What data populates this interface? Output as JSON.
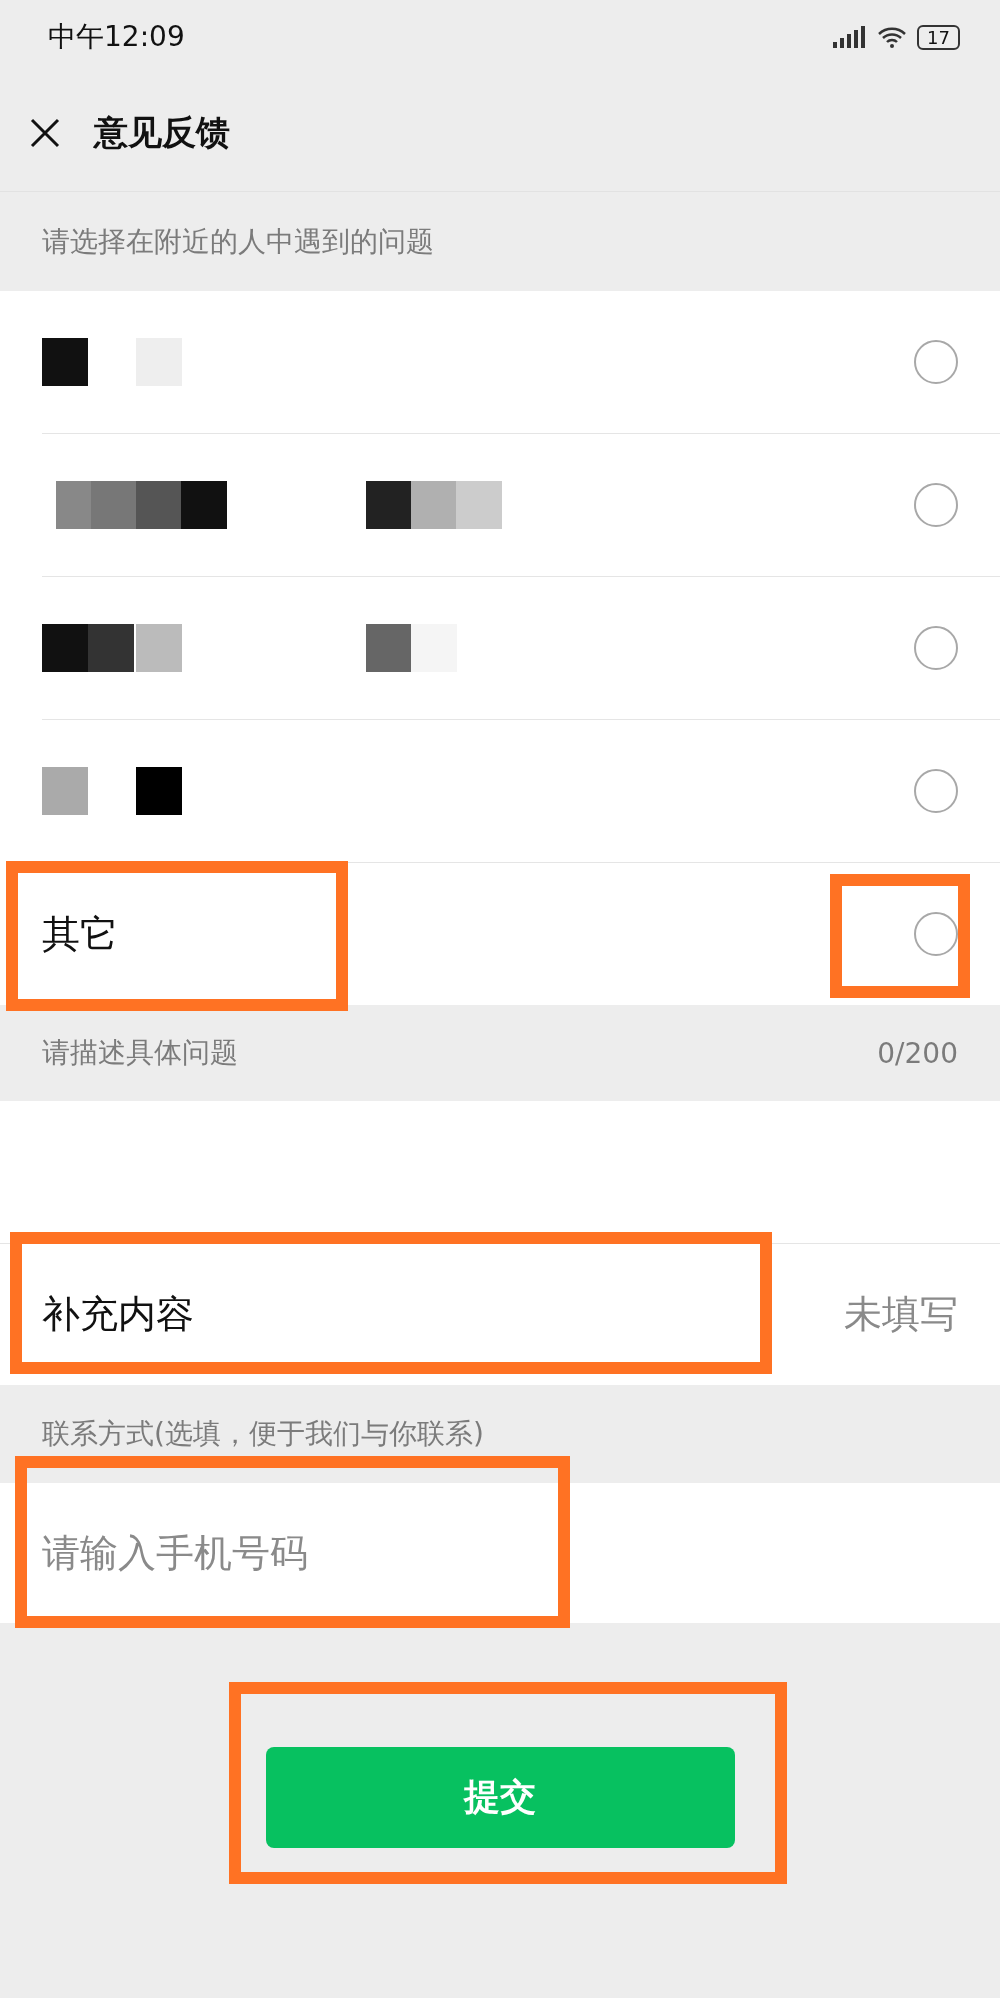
{
  "status_bar": {
    "time": "中午12:09",
    "battery": "17"
  },
  "header": {
    "title": "意见反馈"
  },
  "question": {
    "label": "请选择在附近的人中遇到的问题",
    "options": [
      {
        "kind": "redacted",
        "selected": false,
        "highlighted": false
      },
      {
        "kind": "redacted",
        "selected": false,
        "highlighted": false
      },
      {
        "kind": "redacted",
        "selected": false,
        "highlighted": false
      },
      {
        "kind": "redacted",
        "selected": false,
        "highlighted": false
      },
      {
        "kind": "text",
        "label": "其它",
        "selected": false,
        "highlighted": true
      }
    ]
  },
  "description": {
    "label": "请描述具体问题",
    "counter": "0/200"
  },
  "supplement": {
    "label": "补充内容",
    "value": "未填写",
    "highlighted": true
  },
  "contact": {
    "label": "联系方式(选填，便于我们与你联系)",
    "placeholder": "请输入手机号码",
    "highlighted": true
  },
  "submit": {
    "label": "提交",
    "highlighted": true
  }
}
